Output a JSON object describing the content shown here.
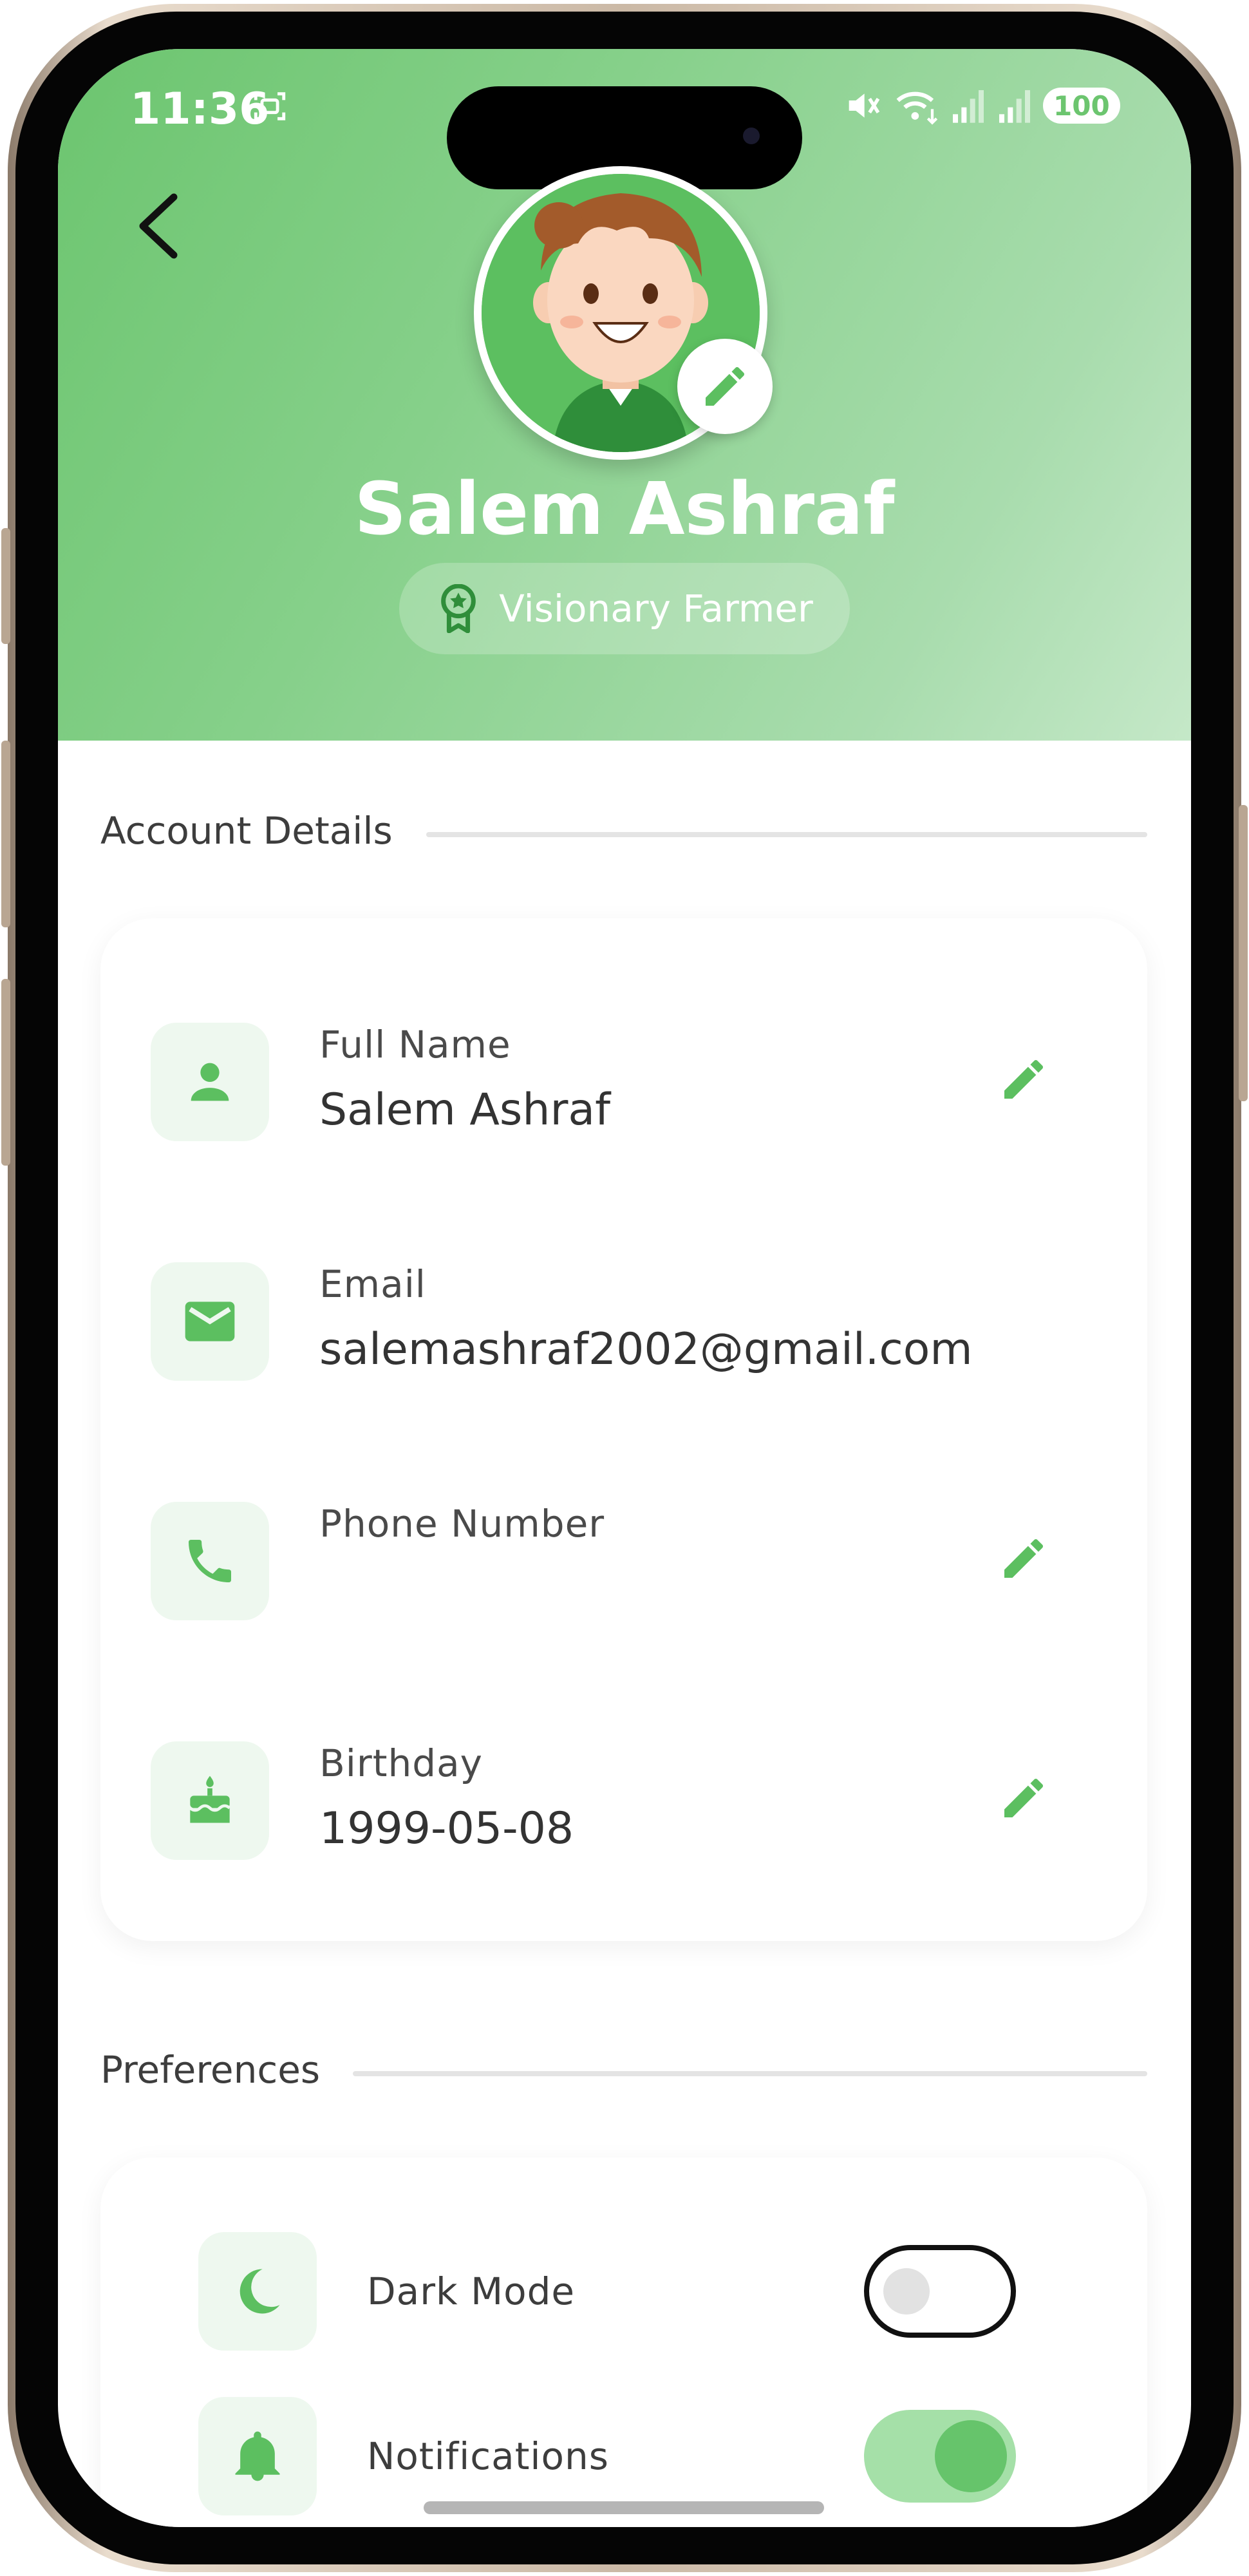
{
  "status_bar": {
    "time": "11:36",
    "battery": "100",
    "icons": [
      "screenshot-icon",
      "mute-icon",
      "wifi-icon",
      "signal-icon",
      "signal-icon"
    ]
  },
  "header": {
    "user_name": "Salem Ashraf",
    "badge_label": "Visionary Farmer",
    "badge_icon": "award-icon"
  },
  "account_details": {
    "title": "Account Details",
    "fields": [
      {
        "label": "Full Name",
        "value": "Salem Ashraf",
        "icon": "person-icon",
        "editable": true
      },
      {
        "label": "Email",
        "value": "salemashraf2002@gmail.com",
        "icon": "email-icon",
        "editable": false
      },
      {
        "label": "Phone Number",
        "value": "",
        "icon": "phone-icon",
        "editable": true
      },
      {
        "label": "Birthday",
        "value": "1999-05-08",
        "icon": "cake-icon",
        "editable": true
      }
    ]
  },
  "preferences": {
    "title": "Preferences",
    "items": [
      {
        "label": "Dark Mode",
        "icon": "moon-icon",
        "enabled": false
      },
      {
        "label": "Notifications",
        "icon": "bell-icon",
        "enabled": true
      }
    ]
  },
  "colors": {
    "accent": "#5cbf60",
    "header_start": "#6cc56f",
    "header_end": "#c5e8c8",
    "icon_tile": "#eef8ef",
    "toggle_on_track": "#a5e0a8",
    "toggle_on_knob": "#66c46b"
  }
}
